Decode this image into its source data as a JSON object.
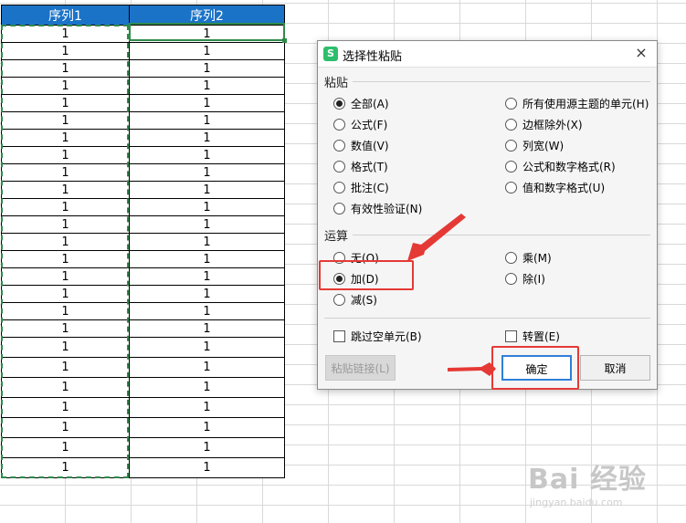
{
  "sheet": {
    "headers": [
      "序列1",
      "序列2"
    ],
    "rows": [
      [
        "1",
        "1"
      ],
      [
        "1",
        "1"
      ],
      [
        "1",
        "1"
      ],
      [
        "1",
        "1"
      ],
      [
        "1",
        "1"
      ],
      [
        "1",
        "1"
      ],
      [
        "1",
        "1"
      ],
      [
        "1",
        "1"
      ],
      [
        "1",
        "1"
      ],
      [
        "1",
        "1"
      ],
      [
        "1",
        "1"
      ],
      [
        "1",
        "1"
      ],
      [
        "1",
        "1"
      ],
      [
        "1",
        "1"
      ],
      [
        "1",
        "1"
      ],
      [
        "1",
        "1"
      ],
      [
        "1",
        "1"
      ],
      [
        "1",
        "1"
      ],
      [
        "1",
        "1"
      ],
      [
        "1",
        "1"
      ],
      [
        "1",
        "1"
      ],
      [
        "1",
        "1"
      ],
      [
        "1",
        "1"
      ],
      [
        "1",
        "1"
      ],
      [
        "1",
        "1"
      ]
    ]
  },
  "dialog": {
    "app_icon": "S",
    "title": "选择性粘贴",
    "close": "×",
    "paste_section": "粘贴",
    "paste_options_left": [
      {
        "label": "全部(A)",
        "checked": true
      },
      {
        "label": "公式(F)",
        "checked": false
      },
      {
        "label": "数值(V)",
        "checked": false
      },
      {
        "label": "格式(T)",
        "checked": false
      },
      {
        "label": "批注(C)",
        "checked": false
      },
      {
        "label": "有效性验证(N)",
        "checked": false
      }
    ],
    "paste_options_right": [
      {
        "label": "所有使用源主题的单元(H)",
        "checked": false
      },
      {
        "label": "边框除外(X)",
        "checked": false
      },
      {
        "label": "列宽(W)",
        "checked": false
      },
      {
        "label": "公式和数字格式(R)",
        "checked": false
      },
      {
        "label": "值和数字格式(U)",
        "checked": false
      }
    ],
    "operation_section": "运算",
    "operation_left": [
      {
        "label": "无(O)",
        "checked": false
      },
      {
        "label": "加(D)",
        "checked": true
      },
      {
        "label": "减(S)",
        "checked": false
      }
    ],
    "operation_right": [
      {
        "label": "乘(M)",
        "checked": false
      },
      {
        "label": "除(I)",
        "checked": false
      }
    ],
    "skip_blanks": "跳过空单元(B)",
    "transpose": "转置(E)",
    "paste_link": "粘贴链接(L)",
    "ok": "确定",
    "cancel": "取消"
  },
  "watermark": {
    "main": "Bai 经验",
    "sub": "jingyan.baidu.com"
  },
  "colors": {
    "header_bg": "#1a73c7",
    "selection_green": "#2e8b4a",
    "highlight_red": "#e53935",
    "primary_border": "#2f7fd8"
  }
}
